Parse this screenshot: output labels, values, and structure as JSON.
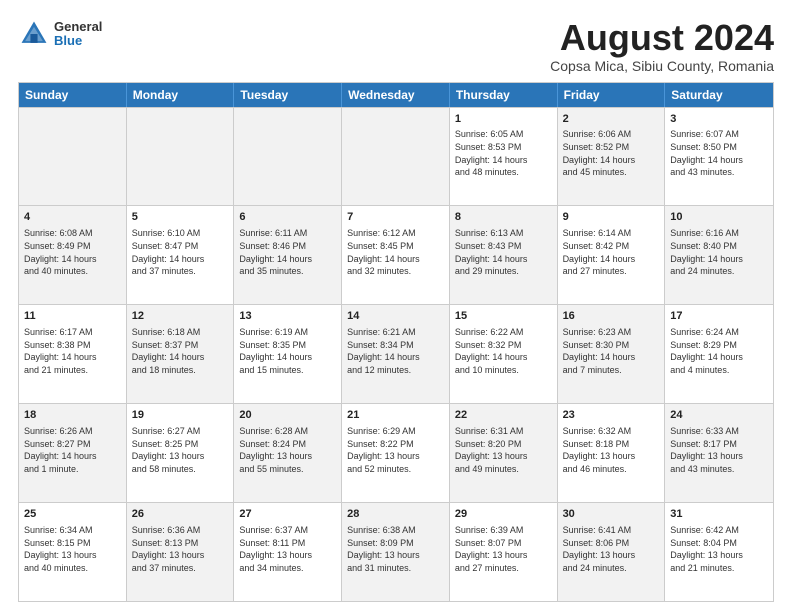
{
  "header": {
    "logo_general": "General",
    "logo_blue": "Blue",
    "month_title": "August 2024",
    "location": "Copsa Mica, Sibiu County, Romania"
  },
  "days_of_week": [
    "Sunday",
    "Monday",
    "Tuesday",
    "Wednesday",
    "Thursday",
    "Friday",
    "Saturday"
  ],
  "weeks": [
    [
      {
        "day": "",
        "info": "",
        "shaded": true
      },
      {
        "day": "",
        "info": "",
        "shaded": true
      },
      {
        "day": "",
        "info": "",
        "shaded": true
      },
      {
        "day": "",
        "info": "",
        "shaded": true
      },
      {
        "day": "1",
        "info": "Sunrise: 6:05 AM\nSunset: 8:53 PM\nDaylight: 14 hours\nand 48 minutes."
      },
      {
        "day": "2",
        "info": "Sunrise: 6:06 AM\nSunset: 8:52 PM\nDaylight: 14 hours\nand 45 minutes.",
        "shaded": true
      },
      {
        "day": "3",
        "info": "Sunrise: 6:07 AM\nSunset: 8:50 PM\nDaylight: 14 hours\nand 43 minutes."
      }
    ],
    [
      {
        "day": "4",
        "info": "Sunrise: 6:08 AM\nSunset: 8:49 PM\nDaylight: 14 hours\nand 40 minutes.",
        "shaded": true
      },
      {
        "day": "5",
        "info": "Sunrise: 6:10 AM\nSunset: 8:47 PM\nDaylight: 14 hours\nand 37 minutes."
      },
      {
        "day": "6",
        "info": "Sunrise: 6:11 AM\nSunset: 8:46 PM\nDaylight: 14 hours\nand 35 minutes.",
        "shaded": true
      },
      {
        "day": "7",
        "info": "Sunrise: 6:12 AM\nSunset: 8:45 PM\nDaylight: 14 hours\nand 32 minutes."
      },
      {
        "day": "8",
        "info": "Sunrise: 6:13 AM\nSunset: 8:43 PM\nDaylight: 14 hours\nand 29 minutes.",
        "shaded": true
      },
      {
        "day": "9",
        "info": "Sunrise: 6:14 AM\nSunset: 8:42 PM\nDaylight: 14 hours\nand 27 minutes."
      },
      {
        "day": "10",
        "info": "Sunrise: 6:16 AM\nSunset: 8:40 PM\nDaylight: 14 hours\nand 24 minutes.",
        "shaded": true
      }
    ],
    [
      {
        "day": "11",
        "info": "Sunrise: 6:17 AM\nSunset: 8:38 PM\nDaylight: 14 hours\nand 21 minutes."
      },
      {
        "day": "12",
        "info": "Sunrise: 6:18 AM\nSunset: 8:37 PM\nDaylight: 14 hours\nand 18 minutes.",
        "shaded": true
      },
      {
        "day": "13",
        "info": "Sunrise: 6:19 AM\nSunset: 8:35 PM\nDaylight: 14 hours\nand 15 minutes."
      },
      {
        "day": "14",
        "info": "Sunrise: 6:21 AM\nSunset: 8:34 PM\nDaylight: 14 hours\nand 12 minutes.",
        "shaded": true
      },
      {
        "day": "15",
        "info": "Sunrise: 6:22 AM\nSunset: 8:32 PM\nDaylight: 14 hours\nand 10 minutes."
      },
      {
        "day": "16",
        "info": "Sunrise: 6:23 AM\nSunset: 8:30 PM\nDaylight: 14 hours\nand 7 minutes.",
        "shaded": true
      },
      {
        "day": "17",
        "info": "Sunrise: 6:24 AM\nSunset: 8:29 PM\nDaylight: 14 hours\nand 4 minutes."
      }
    ],
    [
      {
        "day": "18",
        "info": "Sunrise: 6:26 AM\nSunset: 8:27 PM\nDaylight: 14 hours\nand 1 minute.",
        "shaded": true
      },
      {
        "day": "19",
        "info": "Sunrise: 6:27 AM\nSunset: 8:25 PM\nDaylight: 13 hours\nand 58 minutes."
      },
      {
        "day": "20",
        "info": "Sunrise: 6:28 AM\nSunset: 8:24 PM\nDaylight: 13 hours\nand 55 minutes.",
        "shaded": true
      },
      {
        "day": "21",
        "info": "Sunrise: 6:29 AM\nSunset: 8:22 PM\nDaylight: 13 hours\nand 52 minutes."
      },
      {
        "day": "22",
        "info": "Sunrise: 6:31 AM\nSunset: 8:20 PM\nDaylight: 13 hours\nand 49 minutes.",
        "shaded": true
      },
      {
        "day": "23",
        "info": "Sunrise: 6:32 AM\nSunset: 8:18 PM\nDaylight: 13 hours\nand 46 minutes."
      },
      {
        "day": "24",
        "info": "Sunrise: 6:33 AM\nSunset: 8:17 PM\nDaylight: 13 hours\nand 43 minutes.",
        "shaded": true
      }
    ],
    [
      {
        "day": "25",
        "info": "Sunrise: 6:34 AM\nSunset: 8:15 PM\nDaylight: 13 hours\nand 40 minutes."
      },
      {
        "day": "26",
        "info": "Sunrise: 6:36 AM\nSunset: 8:13 PM\nDaylight: 13 hours\nand 37 minutes.",
        "shaded": true
      },
      {
        "day": "27",
        "info": "Sunrise: 6:37 AM\nSunset: 8:11 PM\nDaylight: 13 hours\nand 34 minutes."
      },
      {
        "day": "28",
        "info": "Sunrise: 6:38 AM\nSunset: 8:09 PM\nDaylight: 13 hours\nand 31 minutes.",
        "shaded": true
      },
      {
        "day": "29",
        "info": "Sunrise: 6:39 AM\nSunset: 8:07 PM\nDaylight: 13 hours\nand 27 minutes."
      },
      {
        "day": "30",
        "info": "Sunrise: 6:41 AM\nSunset: 8:06 PM\nDaylight: 13 hours\nand 24 minutes.",
        "shaded": true
      },
      {
        "day": "31",
        "info": "Sunrise: 6:42 AM\nSunset: 8:04 PM\nDaylight: 13 hours\nand 21 minutes."
      }
    ]
  ]
}
